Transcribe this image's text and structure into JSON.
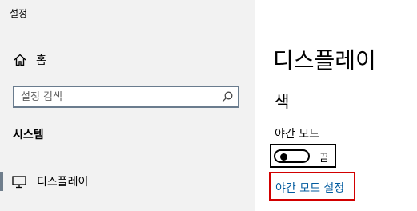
{
  "window": {
    "title": "설정"
  },
  "sidebar": {
    "home": {
      "icon": "home-icon",
      "label": "홈"
    },
    "search": {
      "placeholder": "설정 검색",
      "value": "",
      "icon": "search-icon"
    },
    "section_heading": "시스템",
    "items": [
      {
        "icon": "monitor-icon",
        "label": "디스플레이",
        "selected": true
      }
    ]
  },
  "main": {
    "title": "디스플레이",
    "section": "색",
    "night_light": {
      "label": "야간 모드",
      "toggle_state": "끔",
      "toggle_on": false,
      "settings_link": "야간 모드 설정"
    }
  },
  "colors": {
    "sidebar_background": "#f2f2f2",
    "main_background": "#ffffff",
    "selected_indicator": "#6f7e8c",
    "link": "#005a9e",
    "highlight_border": "#d20000"
  }
}
